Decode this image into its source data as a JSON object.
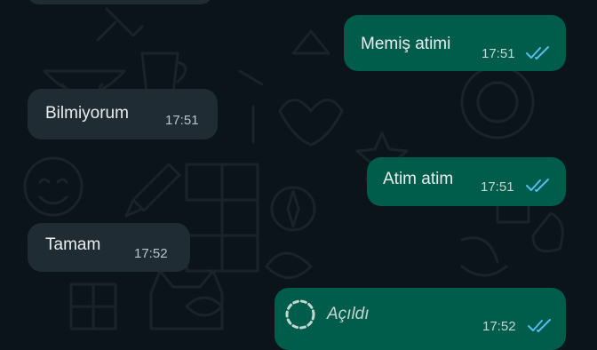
{
  "chat": {
    "messages": [
      {
        "direction": "outgoing",
        "text": "Memiş atimi",
        "time": "17:51",
        "status": "read"
      },
      {
        "direction": "incoming",
        "text": "Bilmiyorum",
        "time": "17:51"
      },
      {
        "direction": "outgoing",
        "text": "Atim atim",
        "time": "17:51",
        "status": "read"
      },
      {
        "direction": "incoming",
        "text": "Tamam",
        "time": "17:52"
      },
      {
        "direction": "outgoing",
        "text": "Açıldı",
        "time": "17:52",
        "status": "read",
        "type": "view-once-opened",
        "icon": "view-once-opened-icon"
      }
    ]
  },
  "colors": {
    "background": "#0b141a",
    "incoming_bubble": "#202c33",
    "outgoing_bubble": "#005c4b",
    "read_ticks": "#53bdeb"
  }
}
